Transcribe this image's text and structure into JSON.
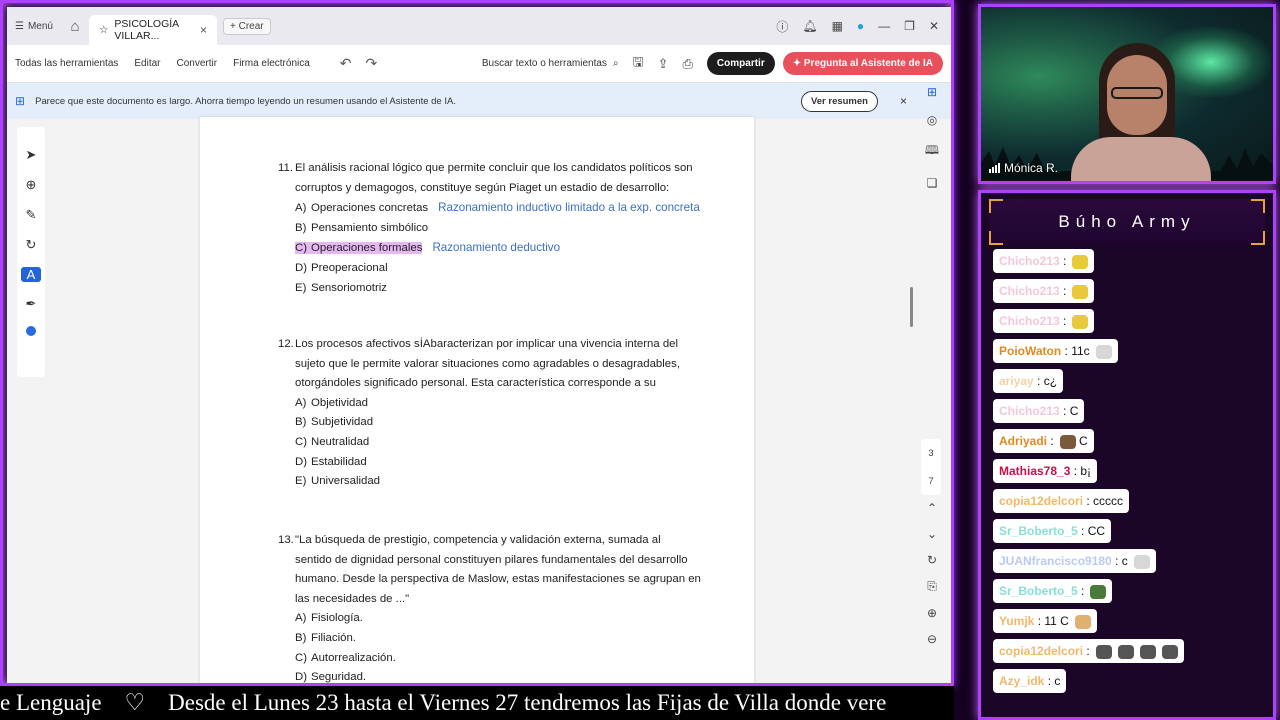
{
  "app": {
    "menu_label": "Menú",
    "tab_title": "PSICOLOGÍA VILLAR...",
    "new_label": "Crear"
  },
  "toolbar": {
    "all_tools": "Todas las herramientas",
    "edit": "Editar",
    "convert": "Convertir",
    "esign": "Firma electrónica",
    "search": "Buscar texto o herramientas",
    "share": "Compartir",
    "ai_ask": "Pregunta al Asistente de IA"
  },
  "banner": {
    "text": "Parece que este documento es largo. Ahorra tiempo leyendo un resumen usando el Asistente de IA.",
    "button": "Ver resumen",
    "close": "×"
  },
  "document": {
    "q11": {
      "number": "11.",
      "line1": "El análisis racional lógico que permite concluir que los candidatos políticos son",
      "line2": "corruptos y demagogos, constituye según Piaget un estadio de desarrollo:",
      "options": [
        {
          "letter": "A)",
          "text": "Operaciones concretas",
          "note": "Razonamiento inductivo limitado  a la exp. concreta"
        },
        {
          "letter": "B)",
          "text": "Pensamiento simbólico",
          "note": ""
        },
        {
          "letter": "C)",
          "text": "Operaciones formales",
          "note": "Razonamiento deductivo"
        },
        {
          "letter": "D)",
          "text": "Preoperacional",
          "note": ""
        },
        {
          "letter": "E)",
          "text": "Sensoriomotriz",
          "note": ""
        }
      ]
    },
    "q12": {
      "number": "12.",
      "line1": "Los procesos afectivos sİAbaracterizan por implicar una vivencia interna del",
      "line2": "sujeto que le permite valorar situaciones como agradables o desagradables,",
      "line3": "otorgándoles significado personal. Esta característica corresponde a su",
      "options": [
        {
          "letter": "A)",
          "text": "Objetividad"
        },
        {
          "letter": "B)",
          "text": "Subjetividad"
        },
        {
          "letter": "C)",
          "text": "Neutralidad"
        },
        {
          "letter": "D)",
          "text": "Estabilidad"
        },
        {
          "letter": "E)",
          "text": "Universalidad"
        }
      ]
    },
    "q13": {
      "number": "13.",
      "line1": "\"La búsqueda de prestigio, competencia y validación externa, sumada al",
      "line2": "sentido de dignidad personal constituyen pilares fundamentales del desarrollo",
      "line3": "humano. Desde la perspectiva de Maslow, estas manifestaciones se agrupan en",
      "line4": "las necesidades de ...\"",
      "options": [
        {
          "letter": "A)",
          "text": "Fisiología."
        },
        {
          "letter": "B)",
          "text": "Filiación."
        },
        {
          "letter": "C)",
          "text": "Autorrealización."
        },
        {
          "letter": "D)",
          "text": "Seguridad."
        }
      ]
    }
  },
  "page_nav": {
    "current": "3",
    "total": "7"
  },
  "ticker": {
    "text": "e Lenguaje    ♡    Desde el Lunes 23 hasta el Viernes 27 tendremos las Fijas de Villa donde vere"
  },
  "webcam": {
    "name": "Mónica R."
  },
  "chat": {
    "title": "Búho Army",
    "messages": [
      {
        "user": "Chicho213",
        "text": ":",
        "color": "#f5c6d8",
        "emote": "yellow"
      },
      {
        "user": "Chicho213",
        "text": ":",
        "color": "#f5c6d8",
        "emote": "yellow"
      },
      {
        "user": "Chicho213",
        "text": ":",
        "color": "#f5c6d8",
        "emote": "yellow"
      },
      {
        "user": "PoioWaton",
        "text": ": 11c",
        "color": "#e08a1e",
        "emote": "hand"
      },
      {
        "user": "ariyay",
        "text": ": c¿",
        "color": "#f2d3a8",
        "emote": ""
      },
      {
        "user": "Chicho213",
        "text": ": C",
        "color": "#f5c6d8",
        "emote": ""
      },
      {
        "user": "Adriyadi",
        "text": ":",
        "color": "#e08a1e",
        "emote": "brown",
        "after": "C"
      },
      {
        "user": "Mathias78_3",
        "text": ": b¡",
        "color": "#c8104a",
        "emote": ""
      },
      {
        "user": "copia12delcori",
        "text": ": ccccc",
        "color": "#f0b86a",
        "emote": ""
      },
      {
        "user": "Sr_Boberto_5",
        "text": ": CC",
        "color": "#86dfd6",
        "emote": ""
      },
      {
        "user": "JUANfrancisco9180",
        "text": ": c",
        "color": "#b9c9f2",
        "emote": "hand"
      },
      {
        "user": "Sr_Boberto_5",
        "text": ":",
        "color": "#86dfd6",
        "emote": "green"
      },
      {
        "user": "Yumjk",
        "text": ": 11 C",
        "color": "#f0b86a",
        "emote": "cat"
      },
      {
        "user": "copia12delcori",
        "text": ":",
        "color": "#f0b86a",
        "emote": "multi"
      },
      {
        "user": "Azy_idk",
        "text": ": c",
        "color": "#f0b86a",
        "emote": ""
      }
    ]
  }
}
